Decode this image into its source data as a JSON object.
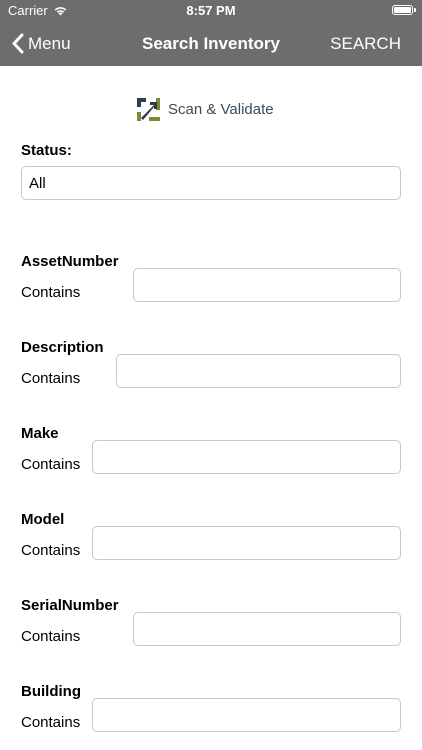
{
  "status_bar": {
    "carrier": "Carrier",
    "time": "8:57 PM"
  },
  "nav": {
    "back_label": "Menu",
    "title": "Search Inventory",
    "action_label": "SEARCH"
  },
  "logo": {
    "text": "Scan & Validate"
  },
  "status_filter": {
    "label": "Status:",
    "value": "All"
  },
  "fields": [
    {
      "label": "AssetNumber",
      "operator": "Contains",
      "value": ""
    },
    {
      "label": "Description",
      "operator": "Contains",
      "value": ""
    },
    {
      "label": "Make",
      "operator": "Contains",
      "value": ""
    },
    {
      "label": "Model",
      "operator": "Contains",
      "value": ""
    },
    {
      "label": "SerialNumber",
      "operator": "Contains",
      "value": ""
    },
    {
      "label": "Building",
      "operator": "Contains",
      "value": ""
    }
  ],
  "colors": {
    "nav_background": "#6d6d6d",
    "logo_green": "#7a8a35",
    "logo_dark": "#2f3d48"
  }
}
